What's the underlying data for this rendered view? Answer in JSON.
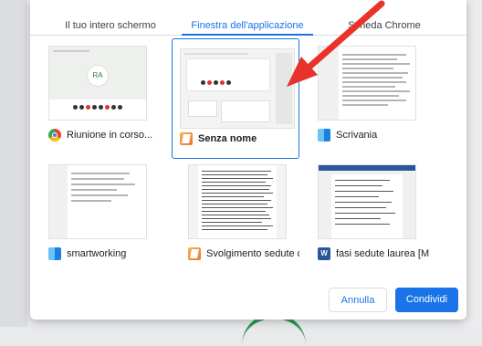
{
  "tabs": [
    {
      "label": "Il tuo intero schermo"
    },
    {
      "label": "Finestra dell'applicazione"
    },
    {
      "label": "Scheda Chrome"
    }
  ],
  "windows": [
    {
      "caption": "Riunione in corso...",
      "icon": "chrome-icon"
    },
    {
      "caption": "Senza nome",
      "icon": "pages-icon",
      "selected": true
    },
    {
      "caption": "Scrivania",
      "icon": "finder-icon"
    },
    {
      "caption": "smartworking",
      "icon": "finder-icon"
    },
    {
      "caption": "Svolgimento sedute di...",
      "icon": "pages-icon"
    },
    {
      "caption": "fasi sedute laurea  [M...",
      "icon": "word-icon"
    }
  ],
  "thumb_meeting_initials": "RA",
  "word_icon_letter": "W",
  "buttons": {
    "cancel": "Annulla",
    "share": "Condividi"
  },
  "colors": {
    "accent": "#1a73e8",
    "arrow": "#e8322b"
  }
}
